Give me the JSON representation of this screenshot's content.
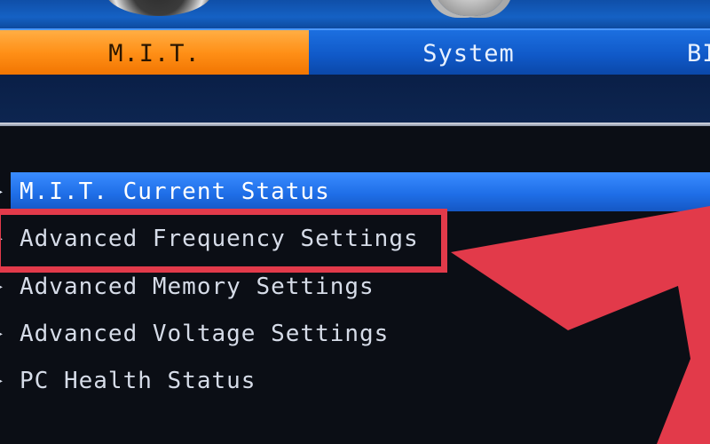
{
  "tabs": {
    "mit": "M.I.T.",
    "system": "System",
    "bios": "BI"
  },
  "menu": {
    "items": [
      {
        "label": "M.I.T. Current Status",
        "selected": true
      },
      {
        "label": "Advanced Frequency Settings",
        "selected": false
      },
      {
        "label": "Advanced Memory Settings",
        "selected": false
      },
      {
        "label": "Advanced Voltage Settings",
        "selected": false
      },
      {
        "label": "PC Health Status",
        "selected": false
      }
    ],
    "arrow_glyph": "▸"
  },
  "annotation": {
    "color": "#e23a4a",
    "highlight_target": "Advanced Frequency Settings"
  },
  "colors": {
    "active_tab": "#ff8f16",
    "tabbar": "#1059c8",
    "selection": "#1f6fe8",
    "background": "#0b0e15"
  }
}
